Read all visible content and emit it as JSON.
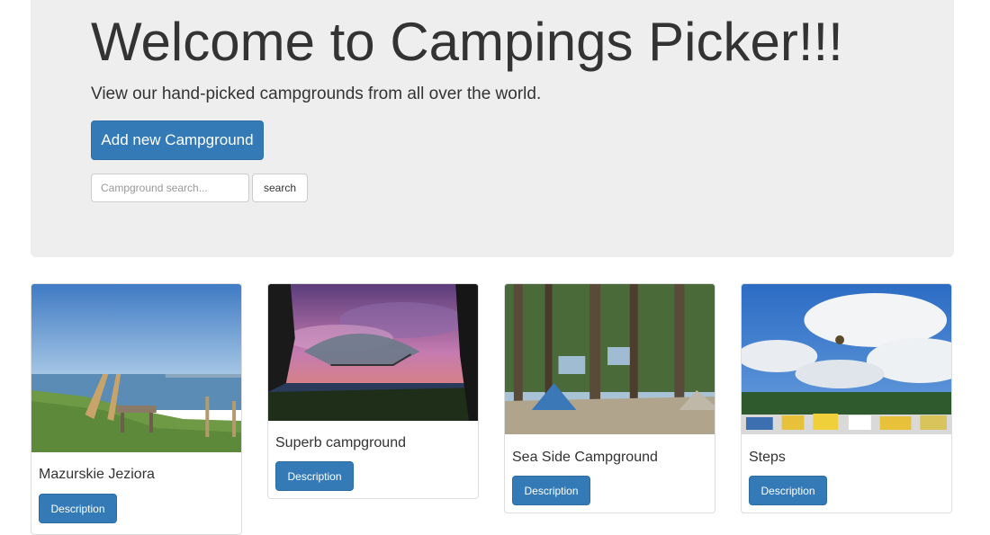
{
  "hero": {
    "title": "Welcome to Campings Picker!!!",
    "subtitle": "View our hand-picked campgrounds from all over the world.",
    "add_button_label": "Add new Campground"
  },
  "search": {
    "placeholder": "Campground search...",
    "button_label": "search"
  },
  "campgrounds": [
    {
      "name": "Mazurskie Jeziora",
      "button_label": "Description"
    },
    {
      "name": "Superb campground",
      "button_label": "Description"
    },
    {
      "name": "Sea Side Campground",
      "button_label": "Description"
    },
    {
      "name": "Steps",
      "button_label": "Description"
    }
  ],
  "colors": {
    "primary": "#337ab7",
    "jumbotron_bg": "#eeeeee",
    "text": "#333333"
  }
}
